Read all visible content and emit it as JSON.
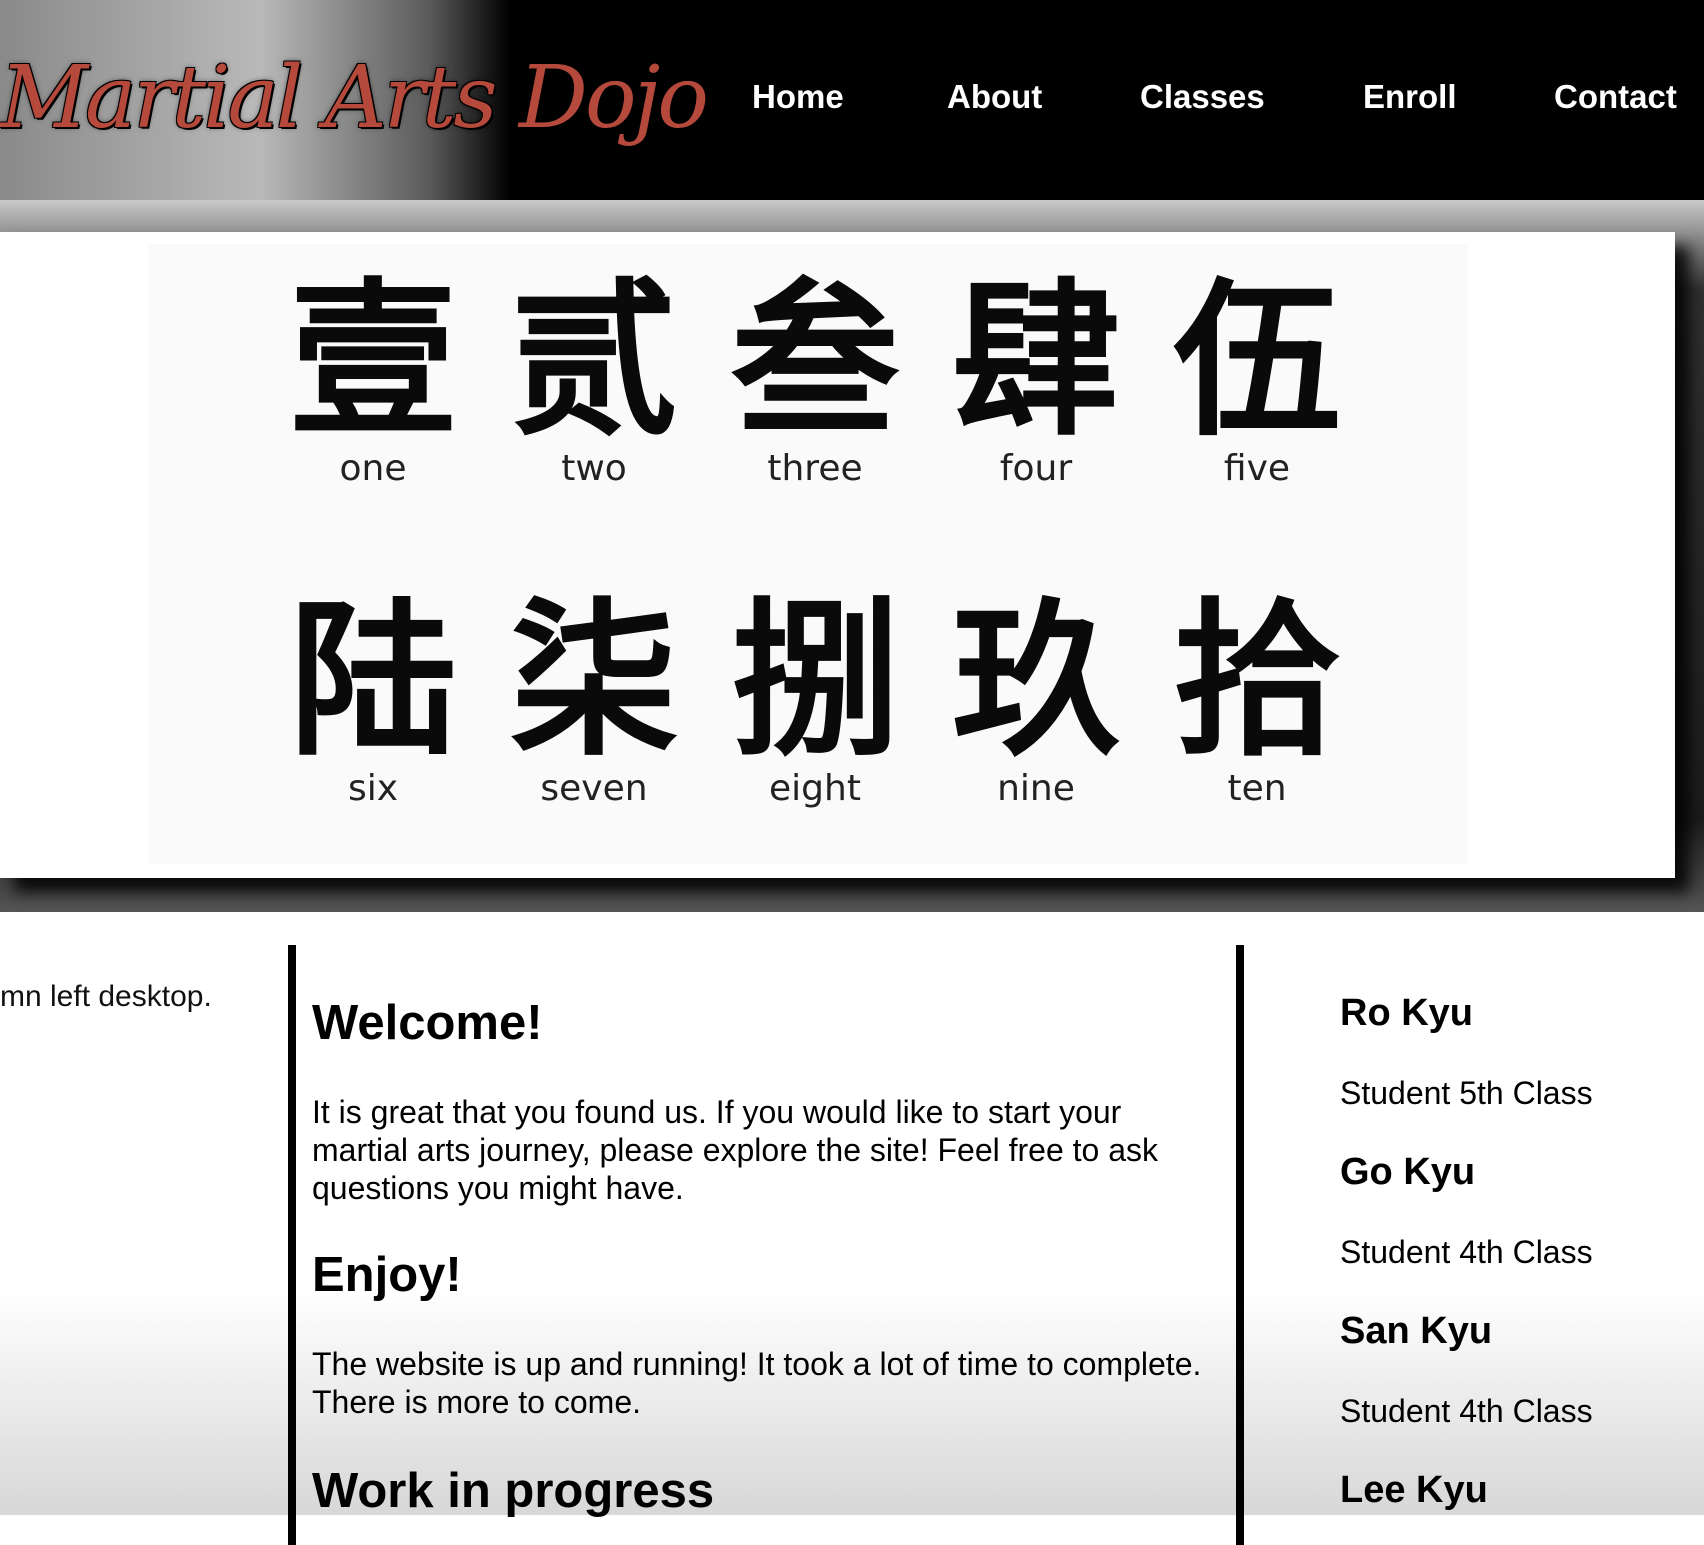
{
  "header": {
    "logo_text": "Martial Arts Dojo",
    "nav": [
      "Home",
      "About",
      "Classes",
      "Enroll",
      "Contact"
    ]
  },
  "banner": {
    "numerals": [
      {
        "kanji": "壹",
        "word": "one"
      },
      {
        "kanji": "贰",
        "word": "two"
      },
      {
        "kanji": "叁",
        "word": "three"
      },
      {
        "kanji": "肆",
        "word": "four"
      },
      {
        "kanji": "伍",
        "word": "five"
      },
      {
        "kanji": "陆",
        "word": "six"
      },
      {
        "kanji": "柒",
        "word": "seven"
      },
      {
        "kanji": "捌",
        "word": "eight"
      },
      {
        "kanji": "玖",
        "word": "nine"
      },
      {
        "kanji": "拾",
        "word": "ten"
      }
    ]
  },
  "left_column": {
    "text": "mn left desktop."
  },
  "main": {
    "sections": [
      {
        "heading": "Welcome!",
        "body": "It is great that you found us. If you would like to start your martial arts journey, please explore the site! Feel free to ask questions you might have."
      },
      {
        "heading": "Enjoy!",
        "body": "The website is up and running! It took a lot of time to complete. There is more to come."
      },
      {
        "heading": "Work in progress",
        "body": ""
      }
    ]
  },
  "ranks": [
    {
      "name": "Ro Kyu",
      "class": "Student 5th Class"
    },
    {
      "name": "Go Kyu",
      "class": "Student 4th Class"
    },
    {
      "name": "San Kyu",
      "class": "Student 4th Class"
    },
    {
      "name": "Lee Kyu",
      "class": ""
    }
  ]
}
